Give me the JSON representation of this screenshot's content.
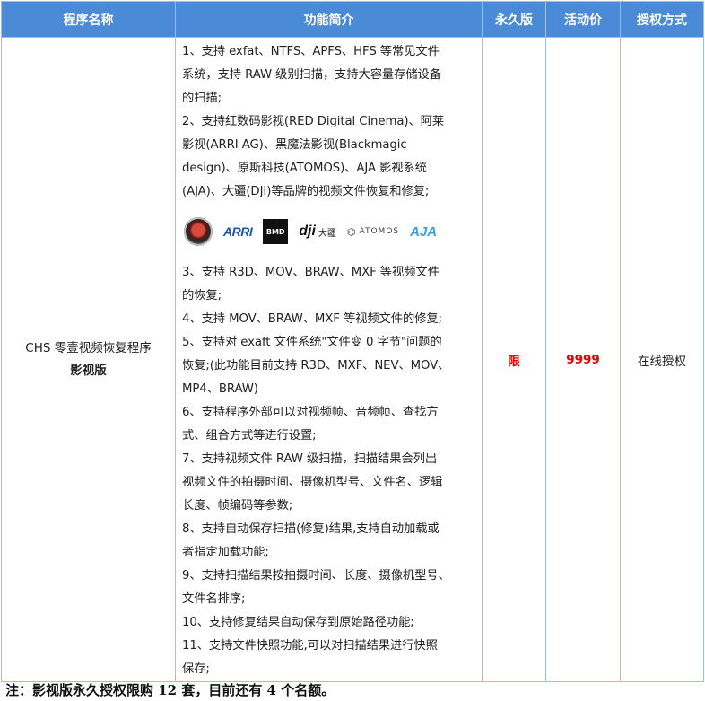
{
  "headers": {
    "name": "程序名称",
    "features": "功能简介",
    "permanent": "永久版",
    "price": "活动价",
    "license": "授权方式"
  },
  "row": {
    "name_line1": "CHS 零壹视频恢复程序",
    "name_line2": "影视版",
    "permanent": "限",
    "price": "9999",
    "license": "在线授权"
  },
  "features_before_logos": [
    "1、支持 exfat、NTFS、APFS、HFS 等常见文件",
    "系统，支持 RAW 级别扫描，支持大容量存储设备",
    "的扫描;",
    "2、支持红数码影视(RED Digital Cinema)、阿莱",
    "影视(ARRI AG)、黑魔法影视(Blackmagic",
    "design)、原斯科技(ATOMOS)、AJA 影视系统",
    "(AJA)、大疆(DJI)等品牌的视频文件恢复和修复;"
  ],
  "logos": {
    "red": "red-logo",
    "arri": "ARRI",
    "bmd": "BMD",
    "dji": "dji",
    "dji_cn": "大疆",
    "atomos": "ATOMOS",
    "aja": "AJA"
  },
  "features_after_logos": [
    "3、支持 R3D、MOV、BRAW、MXF 等视频文件",
    "的恢复;",
    "4、支持 MOV、BRAW、MXF 等视频文件的修复;",
    "5、支持对 exaft 文件系统\"文件变 0 字节\"问题的",
    "恢复;(此功能目前支持 R3D、MXF、NEV、MOV、",
    "MP4、BRAW)",
    "6、支持程序外部可以对视频帧、音频帧、查找方",
    "式、组合方式等进行设置;",
    "7、支持视频文件 RAW 级扫描，扫描结果会列出",
    "视频文件的拍摄时间、摄像机型号、文件名、逻辑",
    "长度、帧编码等参数;",
    "8、支持自动保存扫描(修复)结果,支持自动加载或",
    "者指定加载功能;",
    "9、支持扫描结果按拍摄时间、长度、摄像机型号、",
    "文件名排序;",
    "10、支持修复结果自动保存到原始路径功能;",
    "11、支持文件快照功能,可以对扫描结果进行快照",
    "保存;"
  ],
  "note": "注：影视版永久授权限购 12 套，目前还有 4 个名额。",
  "colors": {
    "header_bg": "#4b8ad6",
    "border": "#9dbfe6",
    "accent_red": "#e60000"
  }
}
